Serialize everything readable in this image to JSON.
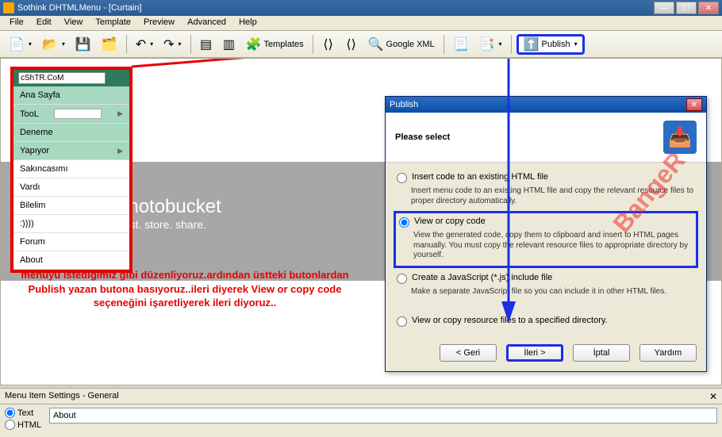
{
  "title": "Sothink DHTMLMenu - [Curtain]",
  "menubar": [
    "File",
    "Edit",
    "View",
    "Template",
    "Preview",
    "Advanced",
    "Help"
  ],
  "toolbar": {
    "templates_label": "Templates",
    "googlexml_label": "Google XML",
    "publish_label": "Publish"
  },
  "menu_preview": {
    "head_value": "cShTR.CoM",
    "items": [
      {
        "label": "Ana Sayfa",
        "green": true
      },
      {
        "label": "TooL",
        "green": true,
        "input": true,
        "arrow": true
      },
      {
        "label": "Deneme",
        "green": true
      },
      {
        "label": "Yapıyor",
        "green": true,
        "arrow": true
      },
      {
        "label": "Sakıncasımı"
      },
      {
        "label": "Vardı"
      },
      {
        "label": "Bilelim"
      },
      {
        "label": ":))))"
      },
      {
        "label": "Forum"
      },
      {
        "label": "About"
      }
    ]
  },
  "instruction": "menüyü istediğimiz gibi düzenliyoruz.ardından üstteki butonlardan Publish yazan butona basıyoruz..ileri diyerek View or copy code seçeneğini işaretliyerek ileri diyoruz..",
  "publish_dialog": {
    "title": "Publish",
    "subtitle": "Please select",
    "option1": {
      "label": "Insert code to an existing HTML file",
      "desc": "Insert menu code to an existing HTML file and copy the relevant resource files to proper directory automatically."
    },
    "option2": {
      "label": "View or copy code",
      "desc": "View the generated code, copy them to clipboard and insert to HTML pages manually. You must copy the relevant resource files to appropriate directory by yourself."
    },
    "option3": {
      "label": "Create a JavaScript (*.js) include file",
      "desc": "Make a separate JavaScript file so you can include it in other HTML files."
    },
    "option4": {
      "label": "View or copy resource files to a specified directory."
    },
    "buttons": {
      "back": "< Geri",
      "next": "İleri >",
      "cancel": "İptal",
      "help": "Yardım"
    }
  },
  "bottom_panel": {
    "title": "Menu Item Settings - General",
    "radio_text": "Text",
    "radio_html": "HTML",
    "text_value": "About"
  },
  "watermark": {
    "brand": "photobucket",
    "tagline": "host. store. share."
  },
  "diag_text": "BangeR"
}
